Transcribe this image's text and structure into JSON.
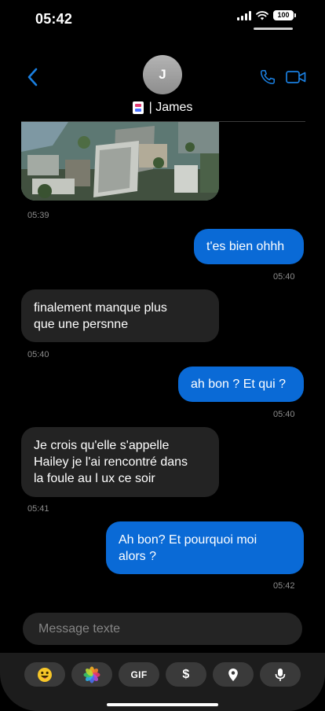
{
  "status": {
    "time": "05:42",
    "battery": "100"
  },
  "header": {
    "avatar_initial": "J",
    "contact_name": "| James"
  },
  "messages": [
    {
      "type": "photo",
      "time": "05:39"
    },
    {
      "dir": "out",
      "text": "t'es bien ohhh",
      "time": "05:40"
    },
    {
      "dir": "in",
      "text": "finalement manque plus\nque une persnne",
      "time": "05:40"
    },
    {
      "dir": "out",
      "text": "ah bon ? Et qui ?",
      "time": "05:40"
    },
    {
      "dir": "in",
      "text": "Je crois qu'elle s'appelle\nHailey je l'ai rencontré dans\nla foule au l ux ce soir",
      "time": "05:41"
    },
    {
      "dir": "out",
      "text": "Ah bon? Et pourquoi moi\nalors ?",
      "time": "05:42"
    }
  ],
  "composer": {
    "placeholder": "Message texte"
  },
  "toolbar": {
    "gif_label": "GIF",
    "dollar_label": "$"
  },
  "colors": {
    "outgoing_bubble": "#0a6ad6",
    "incoming_bubble": "#232323",
    "accent": "#1a7fe0"
  },
  "icons": [
    "chevron-left-icon",
    "phone-icon",
    "video-camera-icon",
    "emoji-icon",
    "photos-icon",
    "gif-icon",
    "dollar-icon",
    "location-pin-icon",
    "microphone-icon"
  ]
}
